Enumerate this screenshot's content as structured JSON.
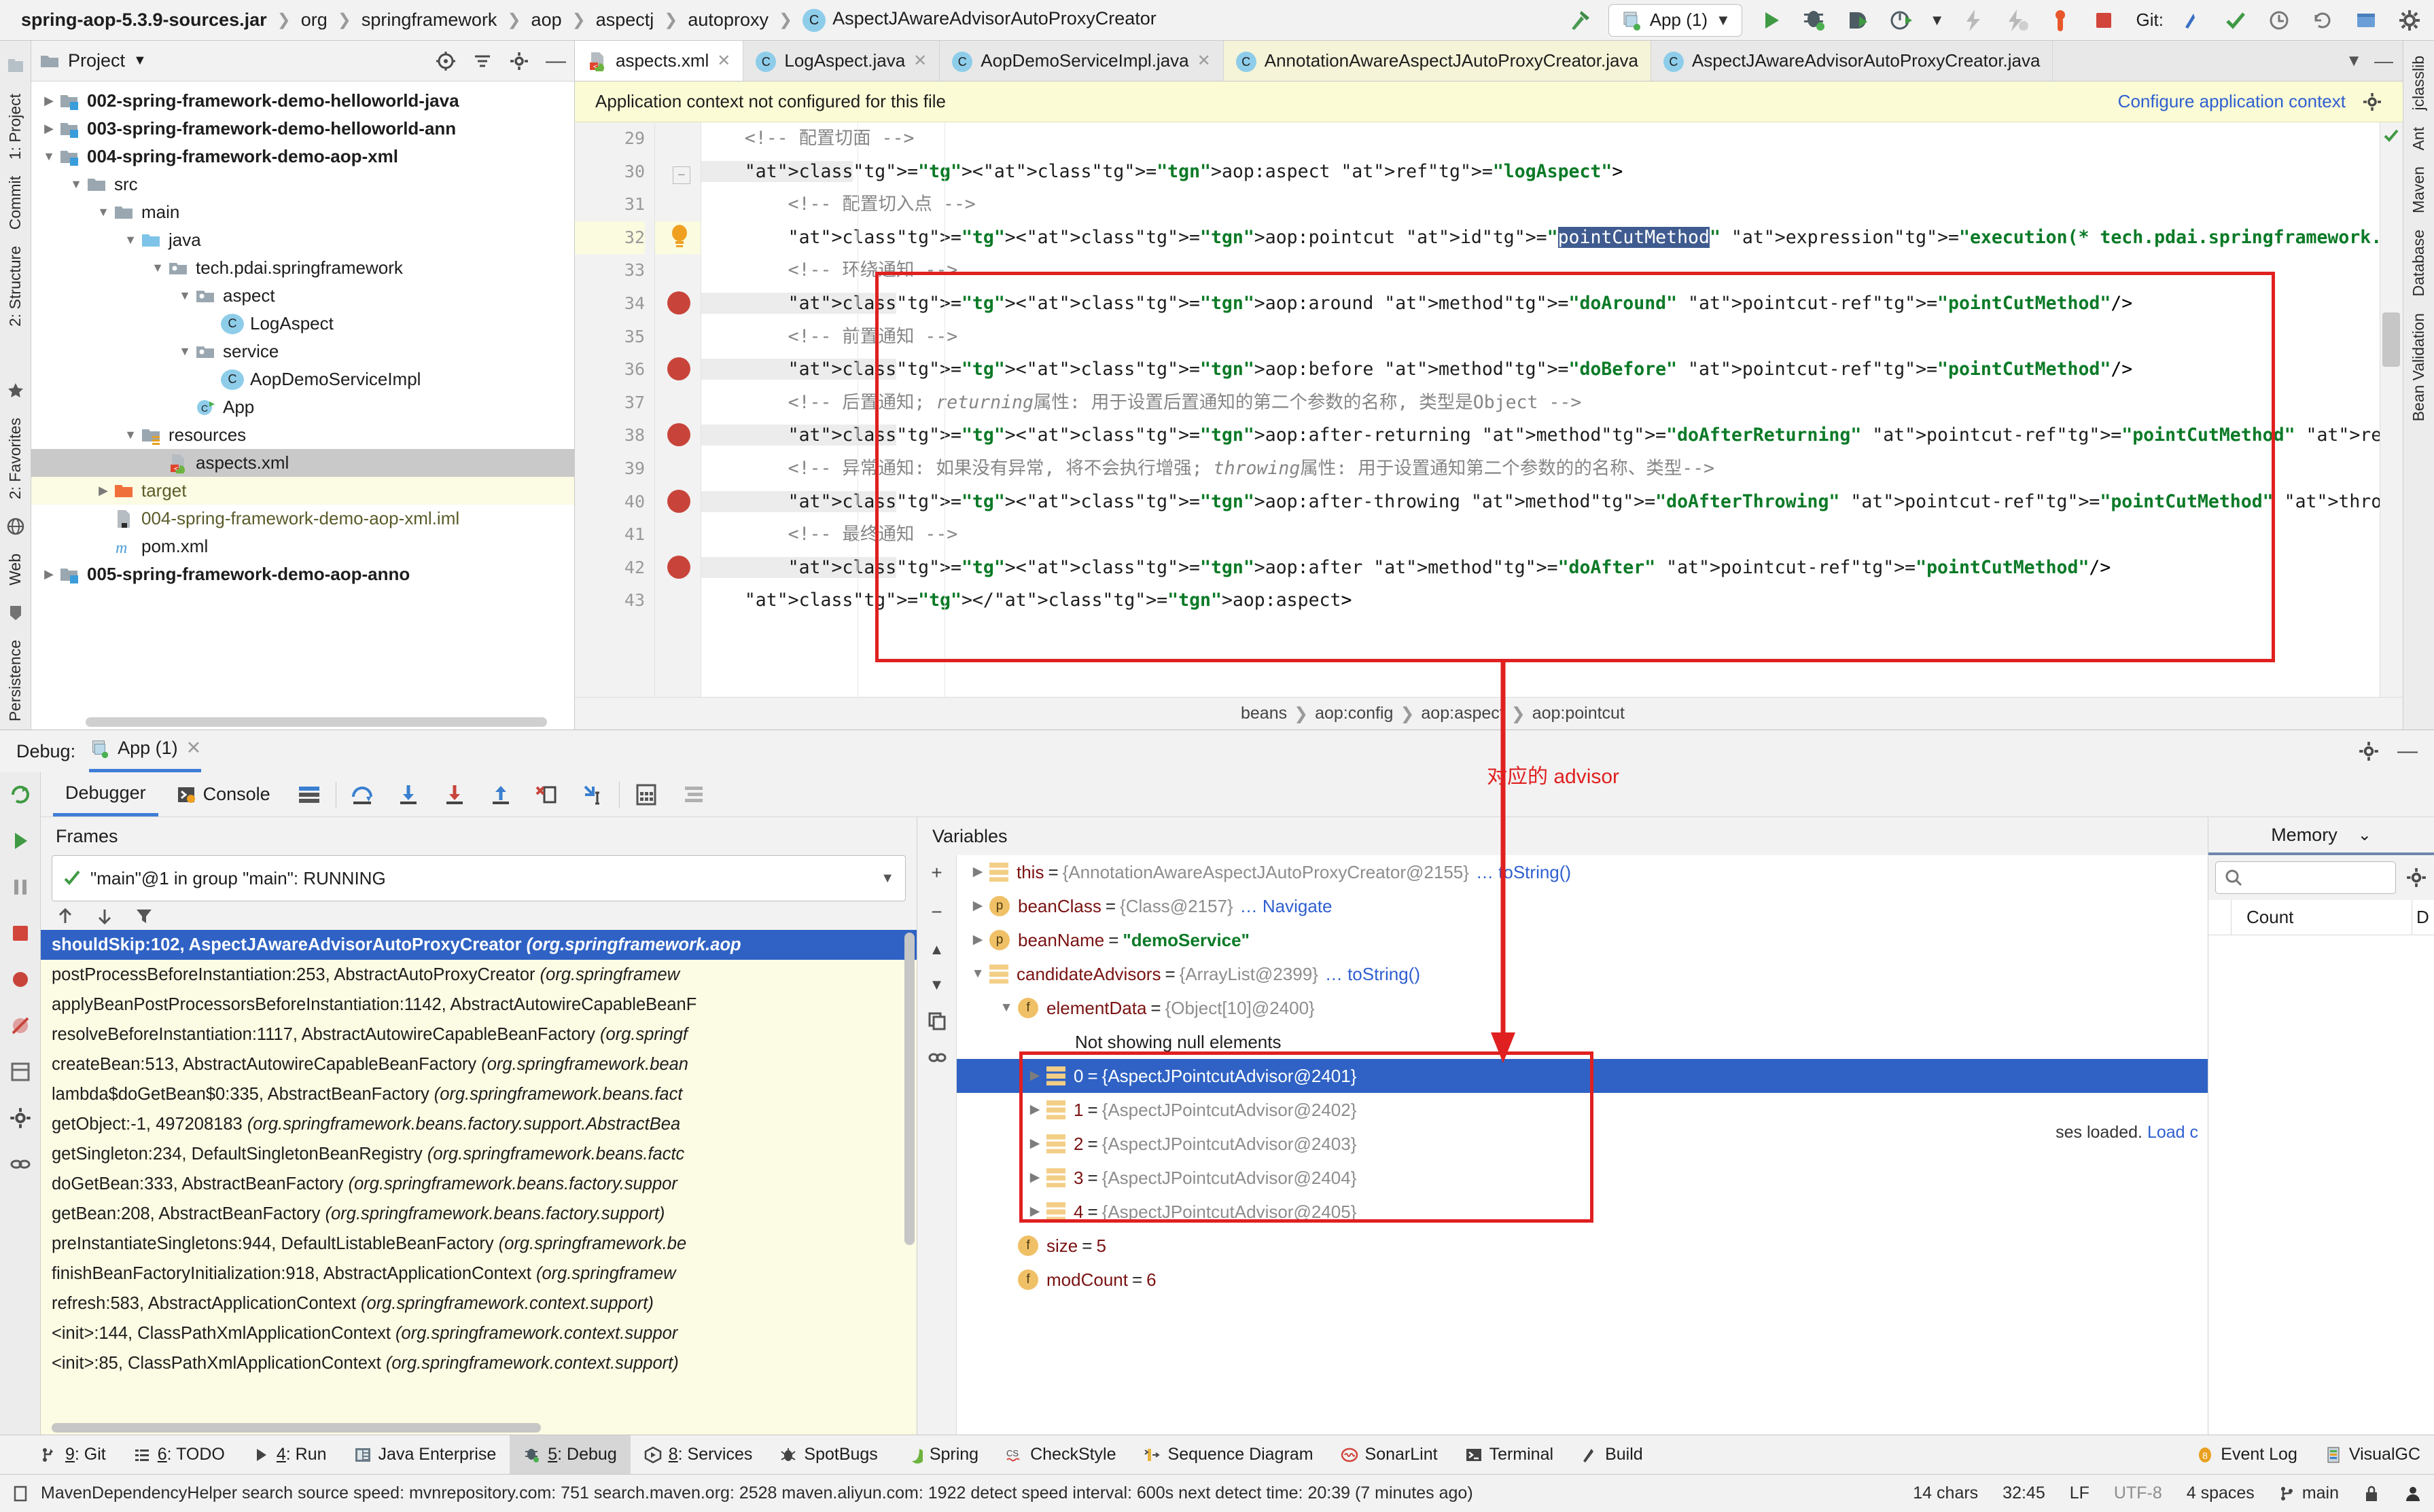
{
  "window": {
    "breadcrumb": [
      {
        "label": "spring-aop-5.3.9-sources.jar",
        "bold": true,
        "icon": null
      },
      {
        "label": "org",
        "bold": false,
        "icon": null
      },
      {
        "label": "springframework",
        "bold": false,
        "icon": null
      },
      {
        "label": "aop",
        "bold": false,
        "icon": null
      },
      {
        "label": "aspectj",
        "bold": false,
        "icon": null
      },
      {
        "label": "autoproxy",
        "bold": false,
        "icon": null
      },
      {
        "label": "AspectJAwareAdvisorAutoProxyCreator",
        "bold": false,
        "icon": "class-icon"
      }
    ],
    "run_config": "App (1)",
    "git_label": "Git:"
  },
  "project": {
    "title": "Project",
    "tree": [
      {
        "label": "002-spring-framework-demo-helloworld-java",
        "indent": 1,
        "twist": "right",
        "icon": "module-icon",
        "bold": true
      },
      {
        "label": "003-spring-framework-demo-helloworld-ann",
        "indent": 1,
        "twist": "right",
        "icon": "module-icon",
        "bold": true
      },
      {
        "label": "004-spring-framework-demo-aop-xml",
        "indent": 1,
        "twist": "down",
        "icon": "module-icon",
        "bold": true
      },
      {
        "label": "src",
        "indent": 2,
        "twist": "down",
        "icon": "folder-icon",
        "bold": false
      },
      {
        "label": "main",
        "indent": 3,
        "twist": "down",
        "icon": "folder-icon",
        "bold": false
      },
      {
        "label": "java",
        "indent": 4,
        "twist": "down",
        "icon": "source-folder-icon",
        "bold": false
      },
      {
        "label": "tech.pdai.springframework",
        "indent": 5,
        "twist": "down",
        "icon": "package-icon",
        "bold": false
      },
      {
        "label": "aspect",
        "indent": 6,
        "twist": "down",
        "icon": "package-icon",
        "bold": false
      },
      {
        "label": "LogAspect",
        "indent": 7,
        "twist": "none",
        "icon": "class-icon",
        "bold": false
      },
      {
        "label": "service",
        "indent": 6,
        "twist": "down",
        "icon": "package-icon",
        "bold": false
      },
      {
        "label": "AopDemoServiceImpl",
        "indent": 7,
        "twist": "none",
        "icon": "class-icon",
        "bold": false
      },
      {
        "label": "App",
        "indent": 6,
        "twist": "none",
        "icon": "runnable-class-icon",
        "bold": false
      },
      {
        "label": "resources",
        "indent": 4,
        "twist": "down",
        "icon": "resource-folder-icon",
        "bold": false
      },
      {
        "label": "aspects.xml",
        "indent": 5,
        "twist": "none",
        "icon": "spring-xml-icon",
        "bold": false,
        "selected": true
      },
      {
        "label": "target",
        "indent": 3,
        "twist": "right",
        "icon": "target-folder-icon",
        "bold": false,
        "highlight": true,
        "olive": true
      },
      {
        "label": "004-spring-framework-demo-aop-xml.iml",
        "indent": 3,
        "twist": "none",
        "icon": "iml-icon",
        "bold": false,
        "olive": true
      },
      {
        "label": "pom.xml",
        "indent": 3,
        "twist": "none",
        "icon": "maven-icon",
        "bold": false
      },
      {
        "label": "005-spring-framework-demo-aop-anno",
        "indent": 1,
        "twist": "right",
        "icon": "module-icon",
        "bold": true
      }
    ]
  },
  "left_rail": [
    "1: Project",
    "Commit",
    "2: Structure"
  ],
  "left_rail_bottom": [
    "2: Favorites",
    "Web",
    "Persistence"
  ],
  "right_rail": [
    "jclasslib",
    "Ant",
    "Maven",
    "Database",
    "Bean Validation"
  ],
  "editor": {
    "tabs": [
      {
        "label": "aspects.xml",
        "icon": "spring-xml-icon",
        "active": true,
        "closable": true
      },
      {
        "label": "LogAspect.java",
        "icon": "class-icon",
        "active": false,
        "closable": true
      },
      {
        "label": "AopDemoServiceImpl.java",
        "icon": "class-icon",
        "active": false,
        "closable": true
      },
      {
        "label": "AnnotationAwareAspectJAutoProxyCreator.java",
        "icon": "class-icon",
        "active": false,
        "closable": false
      },
      {
        "label": "AspectJAwareAdvisorAutoProxyCreator.java",
        "icon": "class-icon",
        "active": false,
        "closable": false
      }
    ],
    "notification": "Application context not configured for this file",
    "notification_link": "Configure application context",
    "first_line_number": 29,
    "lines": [
      {
        "n": 29,
        "indent": 1,
        "kind": "comment",
        "text": "<!-- 配置切面 -->"
      },
      {
        "n": 30,
        "indent": 1,
        "kind": "tag",
        "text": "<aop:aspect ref=\"logAspect\">",
        "soft": true,
        "fold": "minus"
      },
      {
        "n": 31,
        "indent": 2,
        "kind": "comment",
        "text": "<!-- 配置切入点 -->"
      },
      {
        "n": 32,
        "indent": 2,
        "kind": "pointcut",
        "text": "<aop:pointcut id=\"pointCutMethod\" expression=\"execution(* tech.pdai.springframework.service.*.*(..))\"/>",
        "current": true,
        "bulb": true
      },
      {
        "n": 33,
        "indent": 2,
        "kind": "comment",
        "text": "<!-- 环绕通知 -->"
      },
      {
        "n": 34,
        "indent": 2,
        "kind": "tag",
        "text": "<aop:around method=\"doAround\" pointcut-ref=\"pointCutMethod\"/>",
        "soft": true,
        "breakpoint": true
      },
      {
        "n": 35,
        "indent": 2,
        "kind": "comment",
        "text": "<!-- 前置通知 -->"
      },
      {
        "n": 36,
        "indent": 2,
        "kind": "tag",
        "text": "<aop:before method=\"doBefore\" pointcut-ref=\"pointCutMethod\"/>",
        "soft": true,
        "breakpoint": true
      },
      {
        "n": 37,
        "indent": 2,
        "kind": "comment",
        "text": "<!-- 后置通知; returning属性: 用于设置后置通知的第二个参数的名称, 类型是Object -->"
      },
      {
        "n": 38,
        "indent": 2,
        "kind": "tag",
        "text": "<aop:after-returning method=\"doAfterReturning\" pointcut-ref=\"pointCutMethod\" returning=\"result\"/>",
        "soft": true,
        "breakpoint": true
      },
      {
        "n": 39,
        "indent": 2,
        "kind": "comment",
        "text": "<!-- 异常通知: 如果没有异常, 将不会执行增强; throwing属性: 用于设置通知第二个参数的的名称、类型-->"
      },
      {
        "n": 40,
        "indent": 2,
        "kind": "tag",
        "text": "<aop:after-throwing method=\"doAfterThrowing\" pointcut-ref=\"pointCutMethod\" throwing=\"e\"/>",
        "soft": true,
        "breakpoint": true
      },
      {
        "n": 41,
        "indent": 2,
        "kind": "comment",
        "text": "<!-- 最终通知 -->"
      },
      {
        "n": 42,
        "indent": 2,
        "kind": "tag",
        "text": "<aop:after method=\"doAfter\" pointcut-ref=\"pointCutMethod\"/>",
        "soft": true,
        "breakpoint": true
      },
      {
        "n": 43,
        "indent": 1,
        "kind": "tag",
        "text": "</aop:aspect>"
      }
    ],
    "selection": "pointCutMethod",
    "breadcrumb_bottom": [
      "beans",
      "aop:config",
      "aop:aspect",
      "aop:pointcut"
    ]
  },
  "debug": {
    "label": "Debug:",
    "session_tab": "App (1)",
    "tabs": [
      {
        "label": "Debugger",
        "active": true
      },
      {
        "label": "Console",
        "active": false
      }
    ],
    "frames": {
      "title": "Frames",
      "thread": "\"main\"@1 in group \"main\": RUNNING",
      "items": [
        {
          "method": "shouldSkip:102, AspectJAwareAdvisorAutoProxyCreator",
          "pkg": "(org.springframework.aop",
          "selected": true
        },
        {
          "method": "postProcessBeforeInstantiation:253, AbstractAutoProxyCreator",
          "pkg": "(org.springframew",
          "selected": false
        },
        {
          "method": "applyBeanPostProcessorsBeforeInstantiation:1142, AbstractAutowireCapableBeanF",
          "pkg": "",
          "selected": false
        },
        {
          "method": "resolveBeforeInstantiation:1117, AbstractAutowireCapableBeanFactory",
          "pkg": "(org.springf",
          "selected": false
        },
        {
          "method": "createBean:513, AbstractAutowireCapableBeanFactory",
          "pkg": "(org.springframework.bean",
          "selected": false
        },
        {
          "method": "lambda$doGetBean$0:335, AbstractBeanFactory",
          "pkg": "(org.springframework.beans.fact",
          "selected": false
        },
        {
          "method": "getObject:-1, 497208183",
          "pkg": "(org.springframework.beans.factory.support.AbstractBea",
          "selected": false
        },
        {
          "method": "getSingleton:234, DefaultSingletonBeanRegistry",
          "pkg": "(org.springframework.beans.factc",
          "selected": false
        },
        {
          "method": "doGetBean:333, AbstractBeanFactory",
          "pkg": "(org.springframework.beans.factory.suppor",
          "selected": false
        },
        {
          "method": "getBean:208, AbstractBeanFactory",
          "pkg": "(org.springframework.beans.factory.support)",
          "selected": false
        },
        {
          "method": "preInstantiateSingletons:944, DefaultListableBeanFactory",
          "pkg": "(org.springframework.be",
          "selected": false
        },
        {
          "method": "finishBeanFactoryInitialization:918, AbstractApplicationContext",
          "pkg": "(org.springframew",
          "selected": false
        },
        {
          "method": "refresh:583, AbstractApplicationContext",
          "pkg": "(org.springframework.context.support)",
          "selected": false
        },
        {
          "method": "<init>:144, ClassPathXmlApplicationContext",
          "pkg": "(org.springframework.context.suppor",
          "selected": false
        },
        {
          "method": "<init>:85, ClassPathXmlApplicationContext",
          "pkg": "(org.springframework.context.support)",
          "selected": false
        }
      ]
    },
    "variables": {
      "title": "Variables",
      "items": [
        {
          "indent": 0,
          "twist": "right",
          "icon": "stack-icon",
          "name": "this",
          "eq": "=",
          "value": "{AnnotationAwareAspectJAutoProxyCreator@2155}",
          "link": "… toString()"
        },
        {
          "indent": 0,
          "twist": "right",
          "icon": "p",
          "name": "beanClass",
          "eq": "=",
          "value": "{Class@2157}",
          "link": "… Navigate"
        },
        {
          "indent": 0,
          "twist": "right",
          "icon": "p",
          "name": "beanName",
          "eq": "=",
          "value": "\"demoService\"",
          "string": true
        },
        {
          "indent": 0,
          "twist": "down",
          "icon": "stack-icon",
          "name": "candidateAdvisors",
          "eq": "=",
          "value": "{ArrayList@2399}",
          "link": "… toString()"
        },
        {
          "indent": 1,
          "twist": "down",
          "icon": "f",
          "name": "elementData",
          "eq": "=",
          "value": "{Object[10]@2400}"
        },
        {
          "indent": 2,
          "twist": "none",
          "icon": "none",
          "name": "",
          "eq": "",
          "value": "",
          "plain": "Not showing null elements"
        },
        {
          "indent": 2,
          "twist": "right",
          "icon": "stack-icon",
          "name": "0",
          "eq": "=",
          "value": "{AspectJPointcutAdvisor@2401}",
          "selected": true
        },
        {
          "indent": 2,
          "twist": "right",
          "icon": "stack-icon",
          "name": "1",
          "eq": "=",
          "value": "{AspectJPointcutAdvisor@2402}"
        },
        {
          "indent": 2,
          "twist": "right",
          "icon": "stack-icon",
          "name": "2",
          "eq": "=",
          "value": "{AspectJPointcutAdvisor@2403}"
        },
        {
          "indent": 2,
          "twist": "right",
          "icon": "stack-icon",
          "name": "3",
          "eq": "=",
          "value": "{AspectJPointcutAdvisor@2404}"
        },
        {
          "indent": 2,
          "twist": "right",
          "icon": "stack-icon",
          "name": "4",
          "eq": "=",
          "value": "{AspectJPointcutAdvisor@2405}"
        },
        {
          "indent": 1,
          "twist": "none",
          "icon": "f",
          "name": "size",
          "eq": "=",
          "value": "5",
          "num": true
        },
        {
          "indent": 1,
          "twist": "none",
          "icon": "f",
          "name": "modCount",
          "eq": "=",
          "value": "6",
          "num": true
        }
      ]
    },
    "memory": {
      "title": "Memory",
      "search_placeholder": "",
      "columns": [
        "",
        "Count",
        "D"
      ],
      "note": "ses loaded.",
      "note_link": "Load c"
    }
  },
  "annotations": {
    "advisor_label": "对应的 advisor"
  },
  "toolwindows": [
    {
      "label": "9: Git",
      "mnemonic": "9",
      "icon": "git-icon",
      "active": false
    },
    {
      "label": "6: TODO",
      "mnemonic": "6",
      "icon": "todo-icon",
      "active": false
    },
    {
      "label": "4: Run",
      "mnemonic": "4",
      "icon": "run-icon",
      "active": false
    },
    {
      "label": "Java Enterprise",
      "mnemonic": "",
      "icon": "jee-icon",
      "active": false
    },
    {
      "label": "5: Debug",
      "mnemonic": "5",
      "icon": "debug-icon",
      "active": true
    },
    {
      "label": "8: Services",
      "mnemonic": "8",
      "icon": "services-icon",
      "active": false
    },
    {
      "label": "SpotBugs",
      "mnemonic": "",
      "icon": "spotbugs-icon",
      "active": false
    },
    {
      "label": "Spring",
      "mnemonic": "",
      "icon": "spring-icon",
      "active": false
    },
    {
      "label": "CheckStyle",
      "mnemonic": "",
      "icon": "checkstyle-icon",
      "active": false
    },
    {
      "label": "Sequence Diagram",
      "mnemonic": "",
      "icon": "sequence-icon",
      "active": false
    },
    {
      "label": "SonarLint",
      "mnemonic": "",
      "icon": "sonarlint-icon",
      "active": false
    },
    {
      "label": "Terminal",
      "mnemonic": "",
      "icon": "terminal-icon",
      "active": false
    },
    {
      "label": "Build",
      "mnemonic": "",
      "icon": "build-icon",
      "active": false
    },
    {
      "label": "Event Log",
      "mnemonic": "",
      "icon": "eventlog-icon",
      "active": false
    },
    {
      "label": "VisualGC",
      "mnemonic": "",
      "icon": "visualgc-icon",
      "active": false
    }
  ],
  "status": {
    "message": "MavenDependencyHelper search source speed: mvnrepository.com: 751 search.maven.org: 2528 maven.aliyun.com: 1922 detect speed interval: 600s next detect time: 20:39 (7 minutes ago)",
    "chars": "14 chars",
    "caret": "32:45",
    "line_sep": "LF",
    "encoding": "UTF-8",
    "indent": "4 spaces",
    "branch": "main"
  },
  "colors": {
    "accent": "#2f62c4",
    "annotation_red": "#e02020",
    "warn_yellow": "#fbfbd5",
    "green": "#3f9a43"
  }
}
